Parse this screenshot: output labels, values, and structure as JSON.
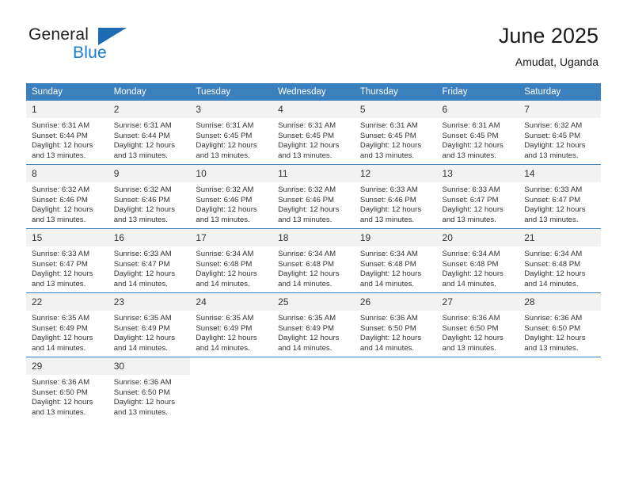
{
  "brand": {
    "name_part1": "General",
    "name_part2": "Blue",
    "triangle_color": "#1b6cb3",
    "blue_color": "#1b7ad1"
  },
  "header": {
    "title": "June 2025",
    "subtitle": "Amudat, Uganda"
  },
  "theme": {
    "header_bg": "#3a7fbe",
    "daynum_bg": "#f2f2f2",
    "text": "#333333"
  },
  "weekdays": [
    "Sunday",
    "Monday",
    "Tuesday",
    "Wednesday",
    "Thursday",
    "Friday",
    "Saturday"
  ],
  "weeks": [
    [
      {
        "day": "1",
        "sunrise": "Sunrise: 6:31 AM",
        "sunset": "Sunset: 6:44 PM",
        "daylight1": "Daylight: 12 hours",
        "daylight2": "and 13 minutes."
      },
      {
        "day": "2",
        "sunrise": "Sunrise: 6:31 AM",
        "sunset": "Sunset: 6:44 PM",
        "daylight1": "Daylight: 12 hours",
        "daylight2": "and 13 minutes."
      },
      {
        "day": "3",
        "sunrise": "Sunrise: 6:31 AM",
        "sunset": "Sunset: 6:45 PM",
        "daylight1": "Daylight: 12 hours",
        "daylight2": "and 13 minutes."
      },
      {
        "day": "4",
        "sunrise": "Sunrise: 6:31 AM",
        "sunset": "Sunset: 6:45 PM",
        "daylight1": "Daylight: 12 hours",
        "daylight2": "and 13 minutes."
      },
      {
        "day": "5",
        "sunrise": "Sunrise: 6:31 AM",
        "sunset": "Sunset: 6:45 PM",
        "daylight1": "Daylight: 12 hours",
        "daylight2": "and 13 minutes."
      },
      {
        "day": "6",
        "sunrise": "Sunrise: 6:31 AM",
        "sunset": "Sunset: 6:45 PM",
        "daylight1": "Daylight: 12 hours",
        "daylight2": "and 13 minutes."
      },
      {
        "day": "7",
        "sunrise": "Sunrise: 6:32 AM",
        "sunset": "Sunset: 6:45 PM",
        "daylight1": "Daylight: 12 hours",
        "daylight2": "and 13 minutes."
      }
    ],
    [
      {
        "day": "8",
        "sunrise": "Sunrise: 6:32 AM",
        "sunset": "Sunset: 6:46 PM",
        "daylight1": "Daylight: 12 hours",
        "daylight2": "and 13 minutes."
      },
      {
        "day": "9",
        "sunrise": "Sunrise: 6:32 AM",
        "sunset": "Sunset: 6:46 PM",
        "daylight1": "Daylight: 12 hours",
        "daylight2": "and 13 minutes."
      },
      {
        "day": "10",
        "sunrise": "Sunrise: 6:32 AM",
        "sunset": "Sunset: 6:46 PM",
        "daylight1": "Daylight: 12 hours",
        "daylight2": "and 13 minutes."
      },
      {
        "day": "11",
        "sunrise": "Sunrise: 6:32 AM",
        "sunset": "Sunset: 6:46 PM",
        "daylight1": "Daylight: 12 hours",
        "daylight2": "and 13 minutes."
      },
      {
        "day": "12",
        "sunrise": "Sunrise: 6:33 AM",
        "sunset": "Sunset: 6:46 PM",
        "daylight1": "Daylight: 12 hours",
        "daylight2": "and 13 minutes."
      },
      {
        "day": "13",
        "sunrise": "Sunrise: 6:33 AM",
        "sunset": "Sunset: 6:47 PM",
        "daylight1": "Daylight: 12 hours",
        "daylight2": "and 13 minutes."
      },
      {
        "day": "14",
        "sunrise": "Sunrise: 6:33 AM",
        "sunset": "Sunset: 6:47 PM",
        "daylight1": "Daylight: 12 hours",
        "daylight2": "and 13 minutes."
      }
    ],
    [
      {
        "day": "15",
        "sunrise": "Sunrise: 6:33 AM",
        "sunset": "Sunset: 6:47 PM",
        "daylight1": "Daylight: 12 hours",
        "daylight2": "and 13 minutes."
      },
      {
        "day": "16",
        "sunrise": "Sunrise: 6:33 AM",
        "sunset": "Sunset: 6:47 PM",
        "daylight1": "Daylight: 12 hours",
        "daylight2": "and 14 minutes."
      },
      {
        "day": "17",
        "sunrise": "Sunrise: 6:34 AM",
        "sunset": "Sunset: 6:48 PM",
        "daylight1": "Daylight: 12 hours",
        "daylight2": "and 14 minutes."
      },
      {
        "day": "18",
        "sunrise": "Sunrise: 6:34 AM",
        "sunset": "Sunset: 6:48 PM",
        "daylight1": "Daylight: 12 hours",
        "daylight2": "and 14 minutes."
      },
      {
        "day": "19",
        "sunrise": "Sunrise: 6:34 AM",
        "sunset": "Sunset: 6:48 PM",
        "daylight1": "Daylight: 12 hours",
        "daylight2": "and 14 minutes."
      },
      {
        "day": "20",
        "sunrise": "Sunrise: 6:34 AM",
        "sunset": "Sunset: 6:48 PM",
        "daylight1": "Daylight: 12 hours",
        "daylight2": "and 14 minutes."
      },
      {
        "day": "21",
        "sunrise": "Sunrise: 6:34 AM",
        "sunset": "Sunset: 6:48 PM",
        "daylight1": "Daylight: 12 hours",
        "daylight2": "and 14 minutes."
      }
    ],
    [
      {
        "day": "22",
        "sunrise": "Sunrise: 6:35 AM",
        "sunset": "Sunset: 6:49 PM",
        "daylight1": "Daylight: 12 hours",
        "daylight2": "and 14 minutes."
      },
      {
        "day": "23",
        "sunrise": "Sunrise: 6:35 AM",
        "sunset": "Sunset: 6:49 PM",
        "daylight1": "Daylight: 12 hours",
        "daylight2": "and 14 minutes."
      },
      {
        "day": "24",
        "sunrise": "Sunrise: 6:35 AM",
        "sunset": "Sunset: 6:49 PM",
        "daylight1": "Daylight: 12 hours",
        "daylight2": "and 14 minutes."
      },
      {
        "day": "25",
        "sunrise": "Sunrise: 6:35 AM",
        "sunset": "Sunset: 6:49 PM",
        "daylight1": "Daylight: 12 hours",
        "daylight2": "and 14 minutes."
      },
      {
        "day": "26",
        "sunrise": "Sunrise: 6:36 AM",
        "sunset": "Sunset: 6:50 PM",
        "daylight1": "Daylight: 12 hours",
        "daylight2": "and 14 minutes."
      },
      {
        "day": "27",
        "sunrise": "Sunrise: 6:36 AM",
        "sunset": "Sunset: 6:50 PM",
        "daylight1": "Daylight: 12 hours",
        "daylight2": "and 13 minutes."
      },
      {
        "day": "28",
        "sunrise": "Sunrise: 6:36 AM",
        "sunset": "Sunset: 6:50 PM",
        "daylight1": "Daylight: 12 hours",
        "daylight2": "and 13 minutes."
      }
    ],
    [
      {
        "day": "29",
        "sunrise": "Sunrise: 6:36 AM",
        "sunset": "Sunset: 6:50 PM",
        "daylight1": "Daylight: 12 hours",
        "daylight2": "and 13 minutes."
      },
      {
        "day": "30",
        "sunrise": "Sunrise: 6:36 AM",
        "sunset": "Sunset: 6:50 PM",
        "daylight1": "Daylight: 12 hours",
        "daylight2": "and 13 minutes."
      },
      {
        "day": "",
        "sunrise": "",
        "sunset": "",
        "daylight1": "",
        "daylight2": ""
      },
      {
        "day": "",
        "sunrise": "",
        "sunset": "",
        "daylight1": "",
        "daylight2": ""
      },
      {
        "day": "",
        "sunrise": "",
        "sunset": "",
        "daylight1": "",
        "daylight2": ""
      },
      {
        "day": "",
        "sunrise": "",
        "sunset": "",
        "daylight1": "",
        "daylight2": ""
      },
      {
        "day": "",
        "sunrise": "",
        "sunset": "",
        "daylight1": "",
        "daylight2": ""
      }
    ]
  ]
}
